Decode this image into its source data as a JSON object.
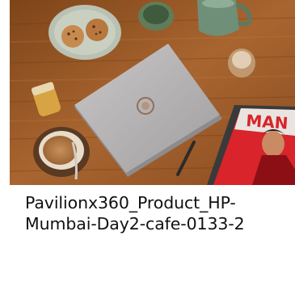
{
  "card": {
    "title": "Pavilionx360_Product_HP-\nMumbai-Day2-cafe-0133-2",
    "image_alt": "Laptop, cookies, tea and magazine on a wooden cafe table"
  },
  "magazine": {
    "masthead": "MAN"
  },
  "colors": {
    "table_wood": "#9a5a28",
    "laptop": "#b5b2b3",
    "magazine_red": "#d8242a",
    "caption_text": "#111111"
  }
}
